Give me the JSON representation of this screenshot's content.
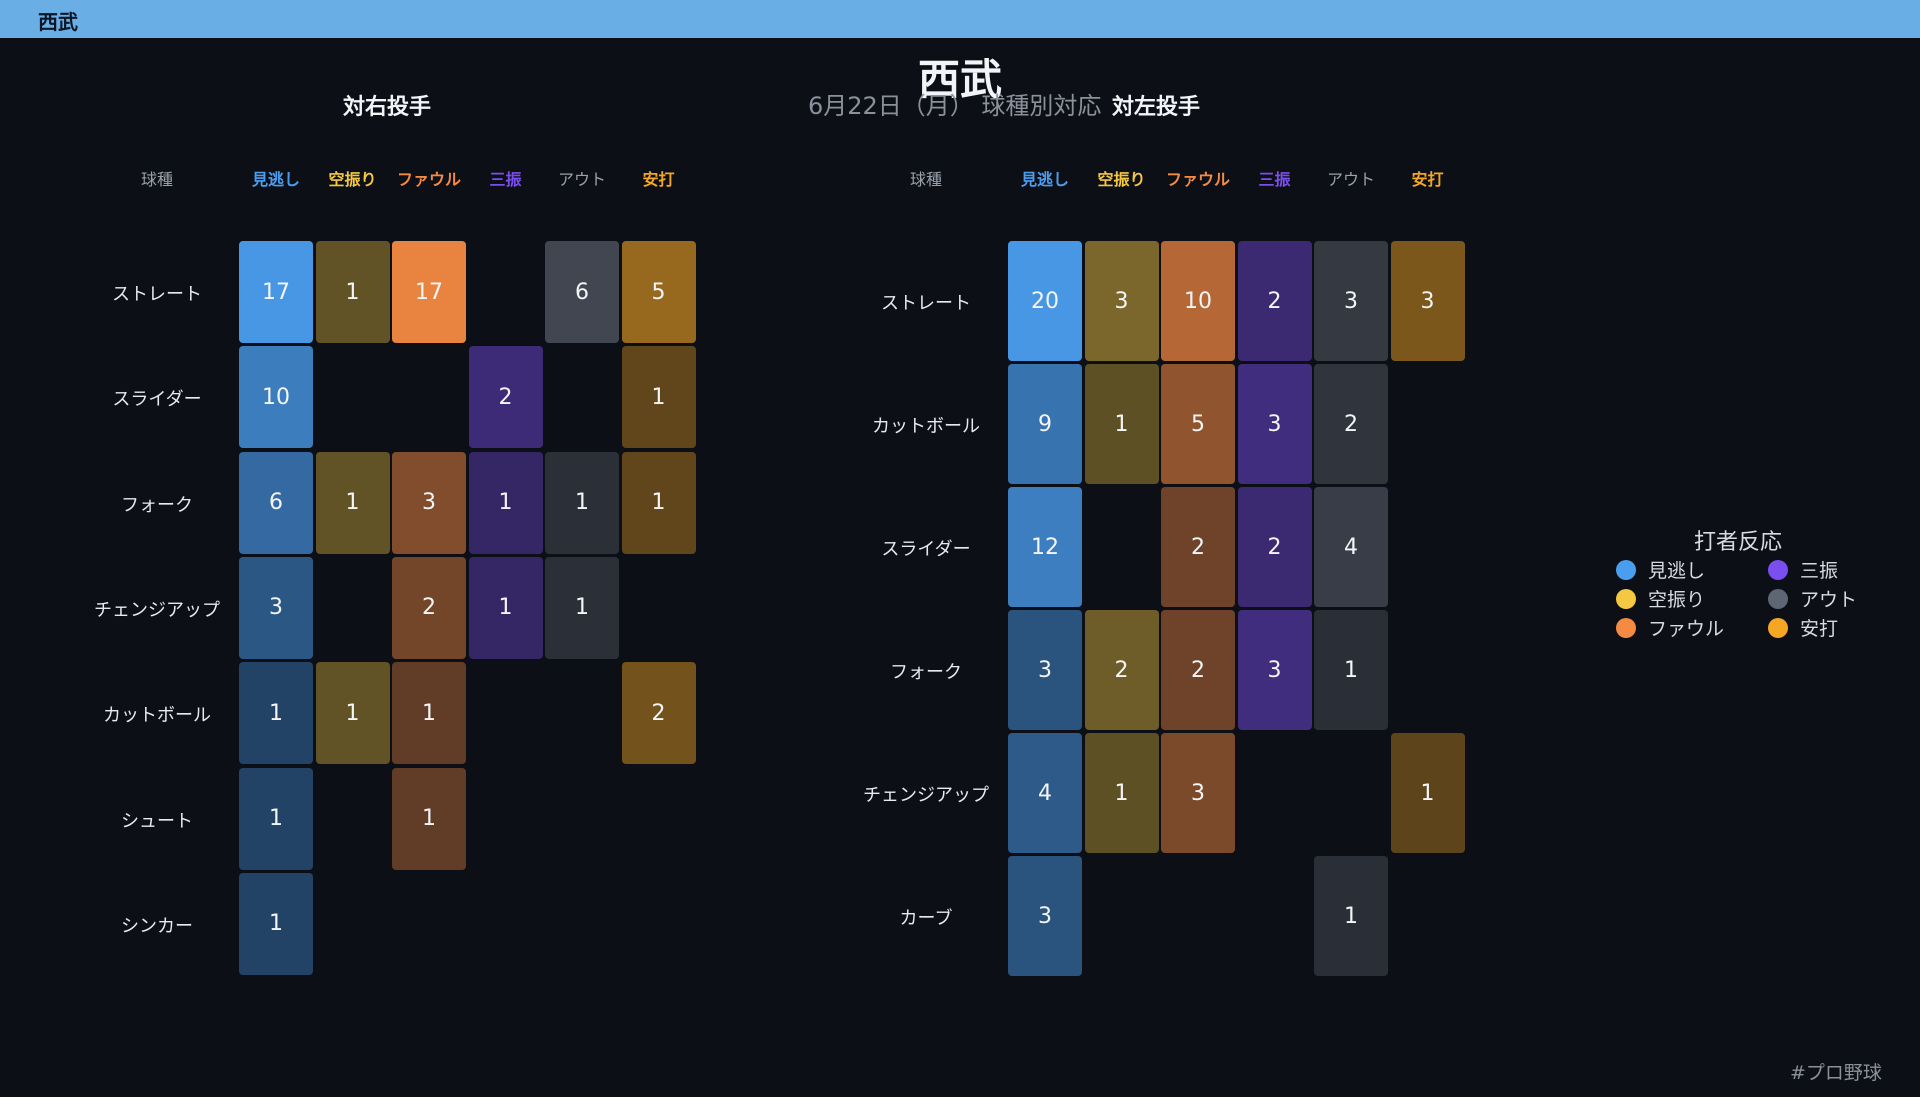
{
  "window": {
    "title": "西武"
  },
  "title": "西武",
  "subtitle": "6月22日（月） 球種別対応",
  "footer_tag": "#プロ野球",
  "legend": {
    "title": "打者反応",
    "items": [
      {
        "label": "見逃し",
        "color": "#4a9ef0"
      },
      {
        "label": "三振",
        "color": "#7b4ef0"
      },
      {
        "label": "空振り",
        "color": "#f5c842"
      },
      {
        "label": "アウト",
        "color": "#5f6673"
      },
      {
        "label": "ファウル",
        "color": "#f58a42"
      },
      {
        "label": "安打",
        "color": "#f5a623"
      }
    ]
  },
  "chart_data": [
    {
      "type": "heatmap",
      "title": "対右投手",
      "row_header": "球種",
      "columns": [
        "見逃し",
        "空振り",
        "ファウル",
        "三振",
        "アウト",
        "安打"
      ],
      "column_colors": [
        "#4a9ef0",
        "#f5c842",
        "#f58a42",
        "#7b4ef0",
        "#9aa0aa",
        "#f5a623"
      ],
      "rows": [
        "ストレート",
        "スライダー",
        "フォーク",
        "チェンジアップ",
        "カットボール",
        "シュート",
        "シンカー"
      ],
      "values": [
        [
          17,
          1,
          17,
          null,
          6,
          5
        ],
        [
          10,
          null,
          null,
          2,
          null,
          1
        ],
        [
          6,
          1,
          3,
          1,
          1,
          1
        ],
        [
          3,
          null,
          2,
          1,
          1,
          null
        ],
        [
          1,
          1,
          1,
          null,
          null,
          2
        ],
        [
          1,
          null,
          1,
          null,
          null,
          null
        ],
        [
          1,
          null,
          null,
          null,
          null,
          null
        ]
      ]
    },
    {
      "type": "heatmap",
      "title": "対左投手",
      "row_header": "球種",
      "columns": [
        "見逃し",
        "空振り",
        "ファウル",
        "三振",
        "アウト",
        "安打"
      ],
      "column_colors": [
        "#4a9ef0",
        "#f5c842",
        "#f58a42",
        "#7b4ef0",
        "#9aa0aa",
        "#f5a623"
      ],
      "rows": [
        "ストレート",
        "カットボール",
        "スライダー",
        "フォーク",
        "チェンジアップ",
        "カーブ"
      ],
      "values": [
        [
          20,
          3,
          10,
          2,
          3,
          3
        ],
        [
          9,
          1,
          5,
          3,
          2,
          null
        ],
        [
          12,
          null,
          2,
          2,
          4,
          null
        ],
        [
          3,
          2,
          2,
          3,
          1,
          null
        ],
        [
          4,
          1,
          3,
          null,
          null,
          1
        ],
        [
          3,
          null,
          null,
          null,
          1,
          null
        ]
      ]
    }
  ]
}
